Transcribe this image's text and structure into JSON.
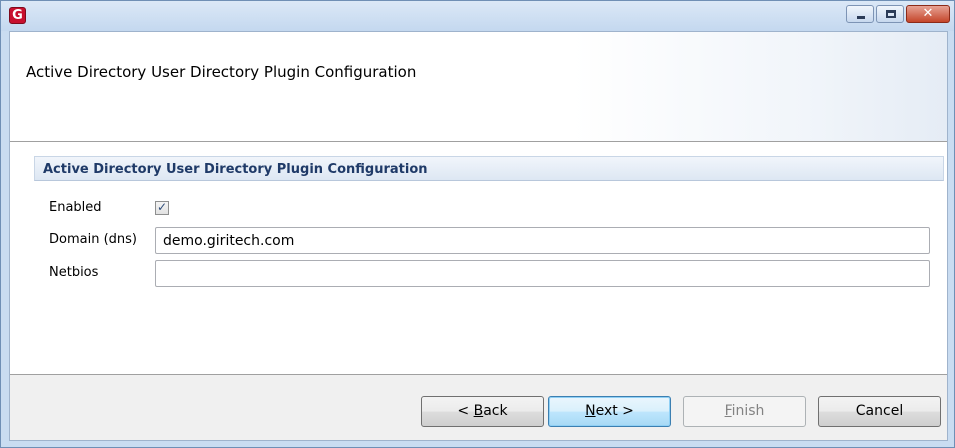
{
  "window": {
    "app_icon_letter": "G",
    "icon": "app-logo-icon",
    "controls": {
      "minimize_icon": "minimize-icon",
      "maximize_icon": "maximize-icon",
      "close_glyph": "✕"
    }
  },
  "page": {
    "title": "Active Directory User Directory Plugin Configuration"
  },
  "section": {
    "title": "Active Directory User Directory Plugin Configuration",
    "fields": {
      "enabled_label": "Enabled",
      "enabled_checked": true,
      "domain_label": "Domain (dns)",
      "domain_value": "demo.giritech.com",
      "domain_placeholder": "",
      "netbios_label": "Netbios",
      "netbios_value": "",
      "netbios_placeholder": ""
    }
  },
  "footer": {
    "back": {
      "prefix": "< ",
      "accel": "B",
      "rest": "ack"
    },
    "next": {
      "accel": "N",
      "rest": "ext >"
    },
    "finish": {
      "accel": "F",
      "rest": "inish"
    },
    "cancel": "Cancel"
  },
  "colors": {
    "title_frame": "#c9dcf1",
    "section_title": "#1f3a68",
    "default_button_border": "#3c7fb1",
    "close_button": "#c4452a",
    "app_icon": "#c8102e"
  }
}
